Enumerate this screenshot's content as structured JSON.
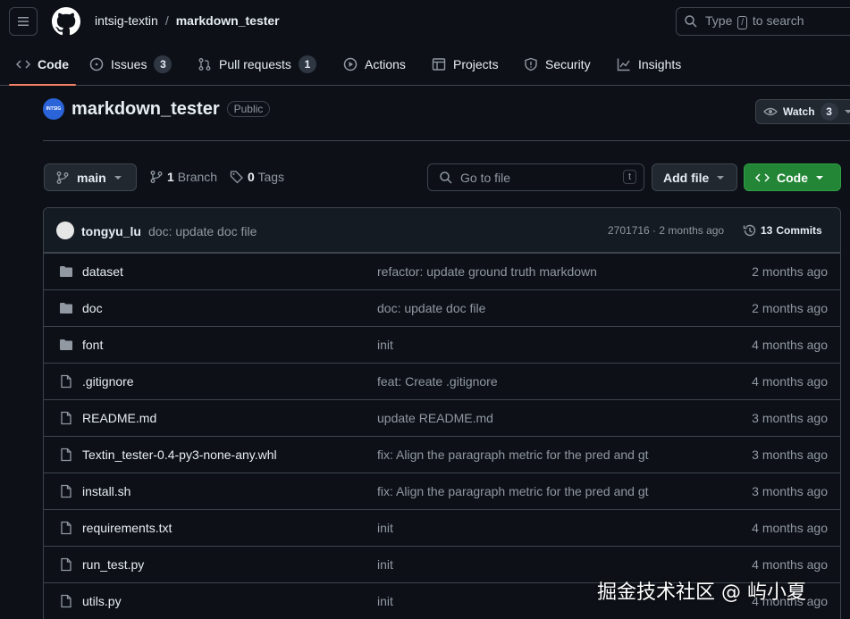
{
  "header": {
    "owner": "intsig-textin",
    "separator": "/",
    "repo": "markdown_tester",
    "search": {
      "prefix": "Type",
      "key": "/",
      "suffix": "to search"
    }
  },
  "tabs": [
    {
      "label": "Code",
      "icon": "code-icon",
      "active": true
    },
    {
      "label": "Issues",
      "icon": "issue-icon",
      "count": "3"
    },
    {
      "label": "Pull requests",
      "icon": "pull-request-icon",
      "count": "1"
    },
    {
      "label": "Actions",
      "icon": "play-icon"
    },
    {
      "label": "Projects",
      "icon": "table-icon"
    },
    {
      "label": "Security",
      "icon": "shield-icon"
    },
    {
      "label": "Insights",
      "icon": "graph-icon"
    }
  ],
  "repo_header": {
    "org_avatar_text": "INTSIG",
    "title": "markdown_tester",
    "visibility": "Public",
    "watch_label": "Watch",
    "watch_count": "3"
  },
  "toolbar": {
    "branch": "main",
    "branch_count": "1",
    "branch_label": "Branch",
    "tag_count": "0",
    "tag_label": "Tags",
    "goto_placeholder": "Go to file",
    "goto_key": "t",
    "add_file": "Add file",
    "code": "Code"
  },
  "latest_commit": {
    "author": "tongyu_lu",
    "message": "doc: update doc file",
    "meta": "2701716 · 2 months ago",
    "commits_count": "13",
    "commits_label": "Commits"
  },
  "files": [
    {
      "name": "dataset",
      "type": "folder",
      "commit": "refactor: update ground truth markdown",
      "date": "2 months ago"
    },
    {
      "name": "doc",
      "type": "folder",
      "commit": "doc: update doc file",
      "date": "2 months ago"
    },
    {
      "name": "font",
      "type": "folder",
      "commit": "init",
      "date": "4 months ago"
    },
    {
      "name": ".gitignore",
      "type": "file",
      "commit": "feat: Create .gitignore",
      "date": "4 months ago"
    },
    {
      "name": "README.md",
      "type": "file",
      "commit": "update README.md",
      "date": "3 months ago"
    },
    {
      "name": "Textin_tester-0.4-py3-none-any.whl",
      "type": "file",
      "commit": "fix: Align the paragraph metric for the pred and gt",
      "date": "3 months ago"
    },
    {
      "name": "install.sh",
      "type": "file",
      "commit": "fix: Align the paragraph metric for the pred and gt",
      "date": "3 months ago"
    },
    {
      "name": "requirements.txt",
      "type": "file",
      "commit": "init",
      "date": "4 months ago"
    },
    {
      "name": "run_test.py",
      "type": "file",
      "commit": "init",
      "date": "4 months ago"
    },
    {
      "name": "utils.py",
      "type": "file",
      "commit": "init",
      "date": "4 months ago"
    }
  ],
  "watermark": "掘金技术社区 @ 屿小夏",
  "colors": {
    "background": "#0d1117",
    "border": "#3d444d",
    "code_button": "#238636",
    "active_tab_underline": "#f78166",
    "muted_text": "#9198a1"
  }
}
